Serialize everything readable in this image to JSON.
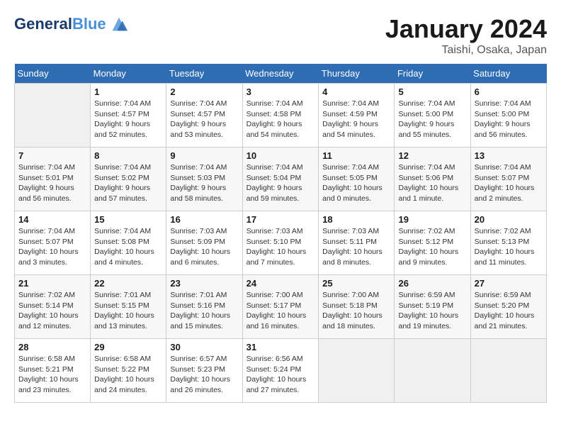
{
  "header": {
    "logo_line1": "General",
    "logo_line2": "Blue",
    "month_title": "January 2024",
    "location": "Taishi, Osaka, Japan"
  },
  "days_of_week": [
    "Sunday",
    "Monday",
    "Tuesday",
    "Wednesday",
    "Thursday",
    "Friday",
    "Saturday"
  ],
  "weeks": [
    [
      {
        "day": "",
        "sunrise": "",
        "sunset": "",
        "daylight": "",
        "empty": true
      },
      {
        "day": "1",
        "sunrise": "Sunrise: 7:04 AM",
        "sunset": "Sunset: 4:57 PM",
        "daylight": "Daylight: 9 hours and 52 minutes."
      },
      {
        "day": "2",
        "sunrise": "Sunrise: 7:04 AM",
        "sunset": "Sunset: 4:57 PM",
        "daylight": "Daylight: 9 hours and 53 minutes."
      },
      {
        "day": "3",
        "sunrise": "Sunrise: 7:04 AM",
        "sunset": "Sunset: 4:58 PM",
        "daylight": "Daylight: 9 hours and 54 minutes."
      },
      {
        "day": "4",
        "sunrise": "Sunrise: 7:04 AM",
        "sunset": "Sunset: 4:59 PM",
        "daylight": "Daylight: 9 hours and 54 minutes."
      },
      {
        "day": "5",
        "sunrise": "Sunrise: 7:04 AM",
        "sunset": "Sunset: 5:00 PM",
        "daylight": "Daylight: 9 hours and 55 minutes."
      },
      {
        "day": "6",
        "sunrise": "Sunrise: 7:04 AM",
        "sunset": "Sunset: 5:00 PM",
        "daylight": "Daylight: 9 hours and 56 minutes."
      }
    ],
    [
      {
        "day": "7",
        "sunrise": "Sunrise: 7:04 AM",
        "sunset": "Sunset: 5:01 PM",
        "daylight": "Daylight: 9 hours and 56 minutes."
      },
      {
        "day": "8",
        "sunrise": "Sunrise: 7:04 AM",
        "sunset": "Sunset: 5:02 PM",
        "daylight": "Daylight: 9 hours and 57 minutes."
      },
      {
        "day": "9",
        "sunrise": "Sunrise: 7:04 AM",
        "sunset": "Sunset: 5:03 PM",
        "daylight": "Daylight: 9 hours and 58 minutes."
      },
      {
        "day": "10",
        "sunrise": "Sunrise: 7:04 AM",
        "sunset": "Sunset: 5:04 PM",
        "daylight": "Daylight: 9 hours and 59 minutes."
      },
      {
        "day": "11",
        "sunrise": "Sunrise: 7:04 AM",
        "sunset": "Sunset: 5:05 PM",
        "daylight": "Daylight: 10 hours and 0 minutes."
      },
      {
        "day": "12",
        "sunrise": "Sunrise: 7:04 AM",
        "sunset": "Sunset: 5:06 PM",
        "daylight": "Daylight: 10 hours and 1 minute."
      },
      {
        "day": "13",
        "sunrise": "Sunrise: 7:04 AM",
        "sunset": "Sunset: 5:07 PM",
        "daylight": "Daylight: 10 hours and 2 minutes."
      }
    ],
    [
      {
        "day": "14",
        "sunrise": "Sunrise: 7:04 AM",
        "sunset": "Sunset: 5:07 PM",
        "daylight": "Daylight: 10 hours and 3 minutes."
      },
      {
        "day": "15",
        "sunrise": "Sunrise: 7:04 AM",
        "sunset": "Sunset: 5:08 PM",
        "daylight": "Daylight: 10 hours and 4 minutes."
      },
      {
        "day": "16",
        "sunrise": "Sunrise: 7:03 AM",
        "sunset": "Sunset: 5:09 PM",
        "daylight": "Daylight: 10 hours and 6 minutes."
      },
      {
        "day": "17",
        "sunrise": "Sunrise: 7:03 AM",
        "sunset": "Sunset: 5:10 PM",
        "daylight": "Daylight: 10 hours and 7 minutes."
      },
      {
        "day": "18",
        "sunrise": "Sunrise: 7:03 AM",
        "sunset": "Sunset: 5:11 PM",
        "daylight": "Daylight: 10 hours and 8 minutes."
      },
      {
        "day": "19",
        "sunrise": "Sunrise: 7:02 AM",
        "sunset": "Sunset: 5:12 PM",
        "daylight": "Daylight: 10 hours and 9 minutes."
      },
      {
        "day": "20",
        "sunrise": "Sunrise: 7:02 AM",
        "sunset": "Sunset: 5:13 PM",
        "daylight": "Daylight: 10 hours and 11 minutes."
      }
    ],
    [
      {
        "day": "21",
        "sunrise": "Sunrise: 7:02 AM",
        "sunset": "Sunset: 5:14 PM",
        "daylight": "Daylight: 10 hours and 12 minutes."
      },
      {
        "day": "22",
        "sunrise": "Sunrise: 7:01 AM",
        "sunset": "Sunset: 5:15 PM",
        "daylight": "Daylight: 10 hours and 13 minutes."
      },
      {
        "day": "23",
        "sunrise": "Sunrise: 7:01 AM",
        "sunset": "Sunset: 5:16 PM",
        "daylight": "Daylight: 10 hours and 15 minutes."
      },
      {
        "day": "24",
        "sunrise": "Sunrise: 7:00 AM",
        "sunset": "Sunset: 5:17 PM",
        "daylight": "Daylight: 10 hours and 16 minutes."
      },
      {
        "day": "25",
        "sunrise": "Sunrise: 7:00 AM",
        "sunset": "Sunset: 5:18 PM",
        "daylight": "Daylight: 10 hours and 18 minutes."
      },
      {
        "day": "26",
        "sunrise": "Sunrise: 6:59 AM",
        "sunset": "Sunset: 5:19 PM",
        "daylight": "Daylight: 10 hours and 19 minutes."
      },
      {
        "day": "27",
        "sunrise": "Sunrise: 6:59 AM",
        "sunset": "Sunset: 5:20 PM",
        "daylight": "Daylight: 10 hours and 21 minutes."
      }
    ],
    [
      {
        "day": "28",
        "sunrise": "Sunrise: 6:58 AM",
        "sunset": "Sunset: 5:21 PM",
        "daylight": "Daylight: 10 hours and 23 minutes."
      },
      {
        "day": "29",
        "sunrise": "Sunrise: 6:58 AM",
        "sunset": "Sunset: 5:22 PM",
        "daylight": "Daylight: 10 hours and 24 minutes."
      },
      {
        "day": "30",
        "sunrise": "Sunrise: 6:57 AM",
        "sunset": "Sunset: 5:23 PM",
        "daylight": "Daylight: 10 hours and 26 minutes."
      },
      {
        "day": "31",
        "sunrise": "Sunrise: 6:56 AM",
        "sunset": "Sunset: 5:24 PM",
        "daylight": "Daylight: 10 hours and 27 minutes."
      },
      {
        "day": "",
        "sunrise": "",
        "sunset": "",
        "daylight": "",
        "empty": true
      },
      {
        "day": "",
        "sunrise": "",
        "sunset": "",
        "daylight": "",
        "empty": true
      },
      {
        "day": "",
        "sunrise": "",
        "sunset": "",
        "daylight": "",
        "empty": true
      }
    ]
  ]
}
